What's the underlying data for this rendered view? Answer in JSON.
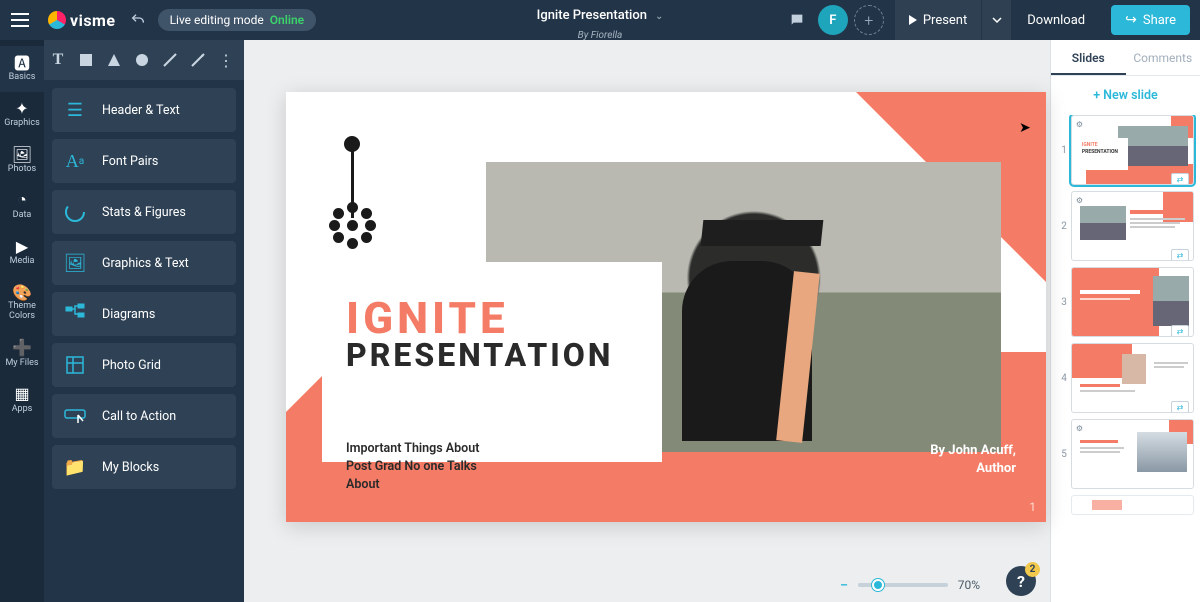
{
  "app": {
    "brand": "visme"
  },
  "mode": {
    "label": "Live editing mode",
    "status": "Online"
  },
  "doc": {
    "title": "Ignite Presentation",
    "author": "By Fiorella"
  },
  "topbar": {
    "avatar_initial": "F",
    "present": "Present",
    "download": "Download",
    "share": "Share"
  },
  "rail": {
    "items": [
      {
        "label": "Basics",
        "icon": "🅰"
      },
      {
        "label": "Graphics",
        "icon": "✦"
      },
      {
        "label": "Photos",
        "icon": "🖼"
      },
      {
        "label": "Data",
        "icon": "◔"
      },
      {
        "label": "Media",
        "icon": "▶"
      },
      {
        "label": "Theme Colors",
        "icon": "🎨"
      },
      {
        "label": "My Files",
        "icon": "➕"
      },
      {
        "label": "Apps",
        "icon": "▦"
      }
    ]
  },
  "panel": {
    "blocks": [
      {
        "label": "Header & Text"
      },
      {
        "label": "Font Pairs"
      },
      {
        "label": "Stats & Figures"
      },
      {
        "label": "Graphics & Text"
      },
      {
        "label": "Diagrams"
      },
      {
        "label": "Photo Grid"
      },
      {
        "label": "Call to Action"
      },
      {
        "label": "My Blocks"
      }
    ]
  },
  "slide": {
    "title1": "IGNITE",
    "title2": "PRESENTATION",
    "subtitle": "Important Things About Post Grad No one Talks About",
    "byline_name": "By John Acuff,",
    "byline_role": "Author",
    "page_number": "1"
  },
  "zoom": {
    "value": "70%"
  },
  "help": {
    "badge": "2"
  },
  "thumbs": {
    "tab_slides": "Slides",
    "tab_comments": "Comments",
    "new_slide": "+ New slide",
    "items": [
      {
        "num": "1",
        "active": true,
        "title1": "IGNITE",
        "title2": "PRESENTATION"
      },
      {
        "num": "2",
        "active": false
      },
      {
        "num": "3",
        "active": false
      },
      {
        "num": "4",
        "active": false
      },
      {
        "num": "5",
        "active": false
      }
    ]
  }
}
